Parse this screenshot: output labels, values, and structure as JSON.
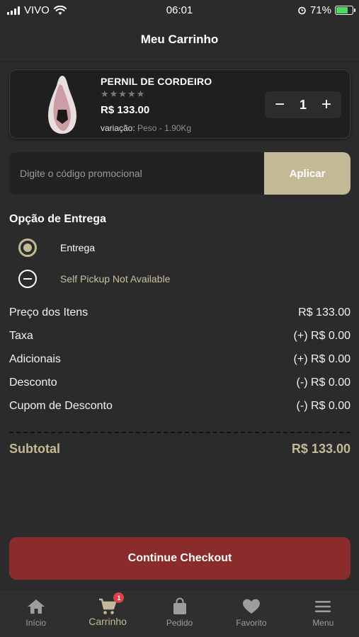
{
  "status_bar": {
    "carrier": "VIVO",
    "time": "06:01",
    "battery_percent": "71%",
    "icons": [
      "signal-icon",
      "wifi-icon",
      "alarm-icon",
      "battery-charging-icon"
    ]
  },
  "header": {
    "title": "Meu Carrinho"
  },
  "cart_item": {
    "name": "PERNIL DE CORDEIRO",
    "stars": "★★★★★",
    "rating_value": 0,
    "price": "R$ 133.00",
    "variation_label": "variação:",
    "variation_value": "Peso - 1.90Kg",
    "quantity": "1",
    "minus_symbol": "−",
    "plus_symbol": "+"
  },
  "promo": {
    "placeholder": "Digite o código promocional",
    "apply_label": "Aplicar"
  },
  "delivery": {
    "title": "Opção de Entrega",
    "options": [
      {
        "label": "Entrega",
        "selected": true
      },
      {
        "label": "Self Pickup Not Available",
        "selected": false
      }
    ]
  },
  "summary": {
    "rows": [
      {
        "label": "Preço dos Itens",
        "value": "R$ 133.00"
      },
      {
        "label": "Taxa",
        "value": "(+) R$ 0.00"
      },
      {
        "label": "Adicionais",
        "value": "(+) R$ 0.00"
      },
      {
        "label": "Desconto",
        "value": "(-) R$ 0.00"
      },
      {
        "label": "Cupom de Desconto",
        "value": "(-) R$ 0.00"
      }
    ],
    "subtotal_label": "Subtotal",
    "subtotal_value": "R$ 133.00"
  },
  "checkout_label": "Continue Checkout",
  "bottom_nav": {
    "items": [
      {
        "label": "Início",
        "icon": "home-icon"
      },
      {
        "label": "Carrinho",
        "icon": "cart-icon",
        "badge": "1",
        "active": true
      },
      {
        "label": "Pedido",
        "icon": "bag-icon"
      },
      {
        "label": "Favorito",
        "icon": "heart-icon"
      },
      {
        "label": "Menu",
        "icon": "menu-icon"
      }
    ]
  },
  "colors": {
    "background": "#2b2b2b",
    "accent": "#c4b996",
    "checkout": "#8b2c2c",
    "badge": "#d9434b"
  }
}
